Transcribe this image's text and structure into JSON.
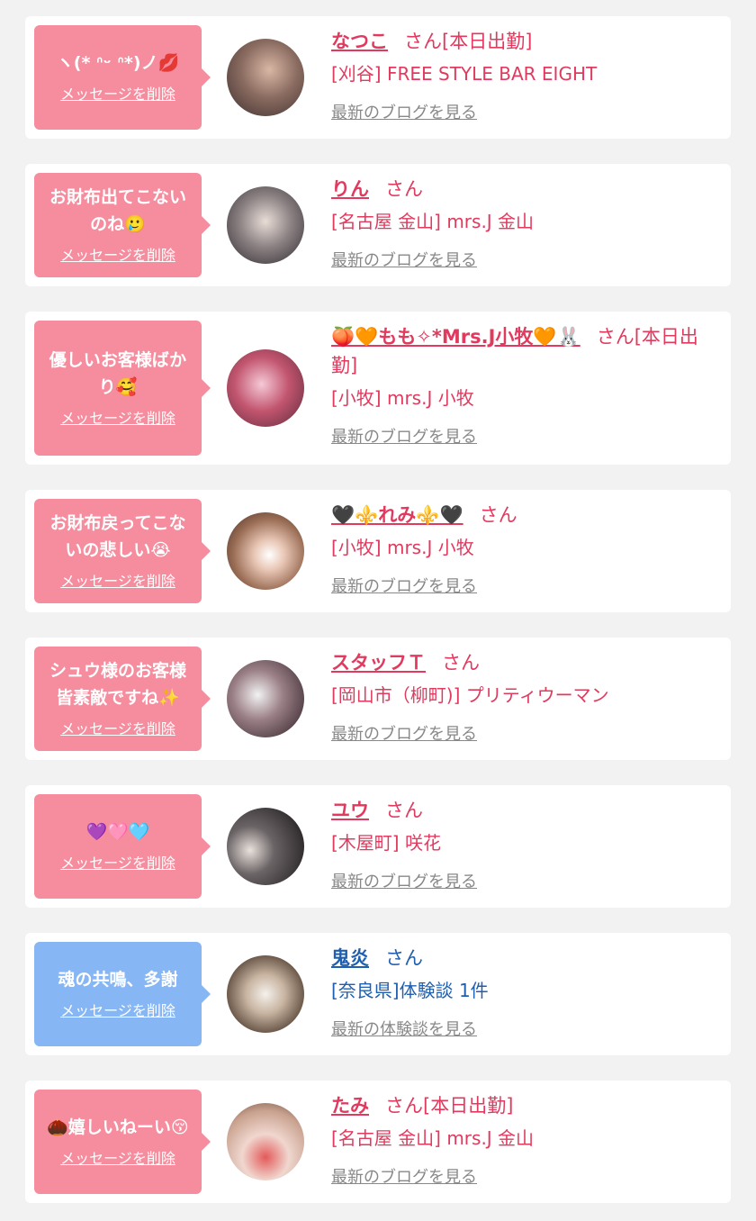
{
  "colors": {
    "pink_bubble": "#f68d9e",
    "blue_bubble": "#86b6f4",
    "pink_text": "#e03a5e",
    "blue_text": "#1f5fb0",
    "link_gray": "#888888"
  },
  "delete_label": "メッセージを削除",
  "entries": [
    {
      "message": "ヽ(* ᐢᵕ ᐢ*)ノ💋",
      "name": "なつこ",
      "suffix": "さん[本日出勤]",
      "shop": "[刈谷] FREE STYLE BAR EIGHT",
      "link": "最新のブログを見る",
      "theme": "pink",
      "avatar_icon": "profile-photo"
    },
    {
      "message": "お財布出てこないのね🥲",
      "name": "りん",
      "suffix": "さん",
      "shop": "[名古屋 金山] mrs.J 金山",
      "link": "最新のブログを見る",
      "theme": "pink",
      "avatar_icon": "profile-photo"
    },
    {
      "message": "優しいお客様ばかり🥰",
      "name": "🍑🧡もも✧*Mrs.J小牧🧡🐰",
      "suffix": "さん[本日出勤]",
      "shop": "[小牧] mrs.J 小牧",
      "link": "最新のブログを見る",
      "theme": "pink",
      "avatar_icon": "profile-photo"
    },
    {
      "message": "お財布戻ってこないの悲しい😭",
      "name": "🖤⚜️れみ⚜️🖤",
      "suffix": "さん",
      "shop": "[小牧] mrs.J 小牧",
      "link": "最新のブログを見る",
      "theme": "pink",
      "avatar_icon": "profile-photo"
    },
    {
      "message": "シュウ様のお客様皆素敵ですね✨",
      "name": "スタッフＴ",
      "suffix": "さん",
      "shop": "[岡山市（柳町)] プリティウーマン",
      "link": "最新のブログを見る",
      "theme": "pink",
      "avatar_icon": "shop-logo"
    },
    {
      "message": "💜🩷🩵",
      "name": "ユウ",
      "suffix": "さん",
      "shop": "[木屋町] 咲花",
      "link": "最新のブログを見る",
      "theme": "pink",
      "avatar_icon": "profile-photo"
    },
    {
      "message": "魂の共鳴、多謝",
      "name": "鬼炎",
      "suffix": "さん",
      "shop": "[奈良県]体験談 1件",
      "link": "最新の体験談を見る",
      "theme": "blue",
      "avatar_icon": "clock-photo"
    },
    {
      "message": "🌰嬉しいねーい😚",
      "name": "たみ",
      "suffix": "さん[本日出勤]",
      "shop": "[名古屋 金山] mrs.J 金山",
      "link": "最新のブログを見る",
      "theme": "pink",
      "avatar_icon": "profile-photo"
    }
  ]
}
